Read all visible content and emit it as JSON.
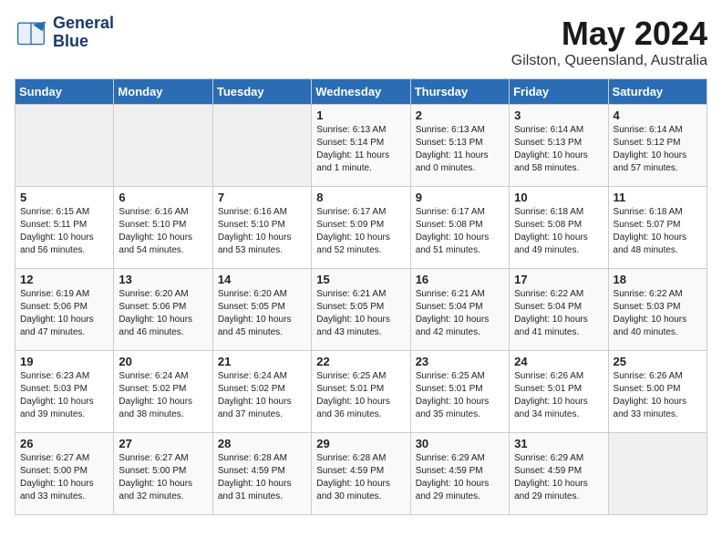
{
  "header": {
    "logo_line1": "General",
    "logo_line2": "Blue",
    "month": "May 2024",
    "location": "Gilston, Queensland, Australia"
  },
  "days_of_week": [
    "Sunday",
    "Monday",
    "Tuesday",
    "Wednesday",
    "Thursday",
    "Friday",
    "Saturday"
  ],
  "weeks": [
    [
      {
        "day": "",
        "sunrise": "",
        "sunset": "",
        "daylight": ""
      },
      {
        "day": "",
        "sunrise": "",
        "sunset": "",
        "daylight": ""
      },
      {
        "day": "",
        "sunrise": "",
        "sunset": "",
        "daylight": ""
      },
      {
        "day": "1",
        "sunrise": "Sunrise: 6:13 AM",
        "sunset": "Sunset: 5:14 PM",
        "daylight": "Daylight: 11 hours and 1 minute."
      },
      {
        "day": "2",
        "sunrise": "Sunrise: 6:13 AM",
        "sunset": "Sunset: 5:13 PM",
        "daylight": "Daylight: 11 hours and 0 minutes."
      },
      {
        "day": "3",
        "sunrise": "Sunrise: 6:14 AM",
        "sunset": "Sunset: 5:13 PM",
        "daylight": "Daylight: 10 hours and 58 minutes."
      },
      {
        "day": "4",
        "sunrise": "Sunrise: 6:14 AM",
        "sunset": "Sunset: 5:12 PM",
        "daylight": "Daylight: 10 hours and 57 minutes."
      }
    ],
    [
      {
        "day": "5",
        "sunrise": "Sunrise: 6:15 AM",
        "sunset": "Sunset: 5:11 PM",
        "daylight": "Daylight: 10 hours and 56 minutes."
      },
      {
        "day": "6",
        "sunrise": "Sunrise: 6:16 AM",
        "sunset": "Sunset: 5:10 PM",
        "daylight": "Daylight: 10 hours and 54 minutes."
      },
      {
        "day": "7",
        "sunrise": "Sunrise: 6:16 AM",
        "sunset": "Sunset: 5:10 PM",
        "daylight": "Daylight: 10 hours and 53 minutes."
      },
      {
        "day": "8",
        "sunrise": "Sunrise: 6:17 AM",
        "sunset": "Sunset: 5:09 PM",
        "daylight": "Daylight: 10 hours and 52 minutes."
      },
      {
        "day": "9",
        "sunrise": "Sunrise: 6:17 AM",
        "sunset": "Sunset: 5:08 PM",
        "daylight": "Daylight: 10 hours and 51 minutes."
      },
      {
        "day": "10",
        "sunrise": "Sunrise: 6:18 AM",
        "sunset": "Sunset: 5:08 PM",
        "daylight": "Daylight: 10 hours and 49 minutes."
      },
      {
        "day": "11",
        "sunrise": "Sunrise: 6:18 AM",
        "sunset": "Sunset: 5:07 PM",
        "daylight": "Daylight: 10 hours and 48 minutes."
      }
    ],
    [
      {
        "day": "12",
        "sunrise": "Sunrise: 6:19 AM",
        "sunset": "Sunset: 5:06 PM",
        "daylight": "Daylight: 10 hours and 47 minutes."
      },
      {
        "day": "13",
        "sunrise": "Sunrise: 6:20 AM",
        "sunset": "Sunset: 5:06 PM",
        "daylight": "Daylight: 10 hours and 46 minutes."
      },
      {
        "day": "14",
        "sunrise": "Sunrise: 6:20 AM",
        "sunset": "Sunset: 5:05 PM",
        "daylight": "Daylight: 10 hours and 45 minutes."
      },
      {
        "day": "15",
        "sunrise": "Sunrise: 6:21 AM",
        "sunset": "Sunset: 5:05 PM",
        "daylight": "Daylight: 10 hours and 43 minutes."
      },
      {
        "day": "16",
        "sunrise": "Sunrise: 6:21 AM",
        "sunset": "Sunset: 5:04 PM",
        "daylight": "Daylight: 10 hours and 42 minutes."
      },
      {
        "day": "17",
        "sunrise": "Sunrise: 6:22 AM",
        "sunset": "Sunset: 5:04 PM",
        "daylight": "Daylight: 10 hours and 41 minutes."
      },
      {
        "day": "18",
        "sunrise": "Sunrise: 6:22 AM",
        "sunset": "Sunset: 5:03 PM",
        "daylight": "Daylight: 10 hours and 40 minutes."
      }
    ],
    [
      {
        "day": "19",
        "sunrise": "Sunrise: 6:23 AM",
        "sunset": "Sunset: 5:03 PM",
        "daylight": "Daylight: 10 hours and 39 minutes."
      },
      {
        "day": "20",
        "sunrise": "Sunrise: 6:24 AM",
        "sunset": "Sunset: 5:02 PM",
        "daylight": "Daylight: 10 hours and 38 minutes."
      },
      {
        "day": "21",
        "sunrise": "Sunrise: 6:24 AM",
        "sunset": "Sunset: 5:02 PM",
        "daylight": "Daylight: 10 hours and 37 minutes."
      },
      {
        "day": "22",
        "sunrise": "Sunrise: 6:25 AM",
        "sunset": "Sunset: 5:01 PM",
        "daylight": "Daylight: 10 hours and 36 minutes."
      },
      {
        "day": "23",
        "sunrise": "Sunrise: 6:25 AM",
        "sunset": "Sunset: 5:01 PM",
        "daylight": "Daylight: 10 hours and 35 minutes."
      },
      {
        "day": "24",
        "sunrise": "Sunrise: 6:26 AM",
        "sunset": "Sunset: 5:01 PM",
        "daylight": "Daylight: 10 hours and 34 minutes."
      },
      {
        "day": "25",
        "sunrise": "Sunrise: 6:26 AM",
        "sunset": "Sunset: 5:00 PM",
        "daylight": "Daylight: 10 hours and 33 minutes."
      }
    ],
    [
      {
        "day": "26",
        "sunrise": "Sunrise: 6:27 AM",
        "sunset": "Sunset: 5:00 PM",
        "daylight": "Daylight: 10 hours and 33 minutes."
      },
      {
        "day": "27",
        "sunrise": "Sunrise: 6:27 AM",
        "sunset": "Sunset: 5:00 PM",
        "daylight": "Daylight: 10 hours and 32 minutes."
      },
      {
        "day": "28",
        "sunrise": "Sunrise: 6:28 AM",
        "sunset": "Sunset: 4:59 PM",
        "daylight": "Daylight: 10 hours and 31 minutes."
      },
      {
        "day": "29",
        "sunrise": "Sunrise: 6:28 AM",
        "sunset": "Sunset: 4:59 PM",
        "daylight": "Daylight: 10 hours and 30 minutes."
      },
      {
        "day": "30",
        "sunrise": "Sunrise: 6:29 AM",
        "sunset": "Sunset: 4:59 PM",
        "daylight": "Daylight: 10 hours and 29 minutes."
      },
      {
        "day": "31",
        "sunrise": "Sunrise: 6:29 AM",
        "sunset": "Sunset: 4:59 PM",
        "daylight": "Daylight: 10 hours and 29 minutes."
      },
      {
        "day": "",
        "sunrise": "",
        "sunset": "",
        "daylight": ""
      }
    ]
  ]
}
